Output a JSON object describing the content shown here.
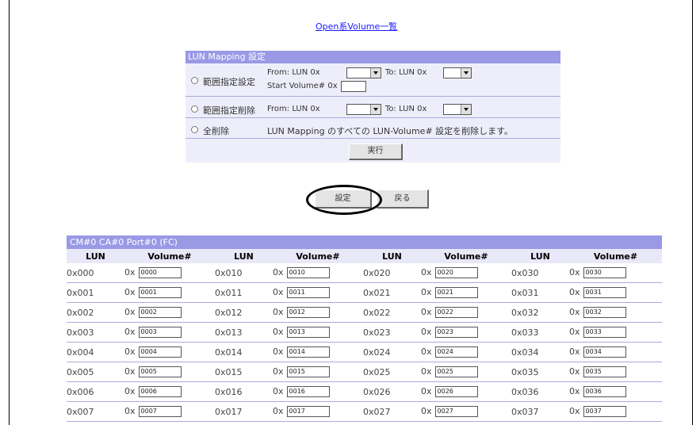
{
  "top_link": "Open系Volume一覧",
  "lun_mapping": {
    "title": "LUN Mapping 設定",
    "range_set": {
      "label": "範囲指定設定",
      "from_label": "From: LUN 0x",
      "to_label": "To: LUN 0x",
      "start_label": "Start Volume# 0x"
    },
    "range_delete": {
      "label": "範囲指定削除",
      "from_label": "From: LUN 0x",
      "to_label": "To: LUN 0x"
    },
    "delete_all": {
      "label": "全削除",
      "description": "LUN Mapping のすべての LUN-Volume# 設定を削除します。"
    },
    "execute_button": "実行"
  },
  "actions": {
    "set_button": "設定",
    "back_button": "戻る"
  },
  "cm_table": {
    "title": "CM#0 CA#0 Port#0 (FC)",
    "headers": [
      "LUN",
      "Volume#",
      "LUN",
      "Volume#",
      "LUN",
      "Volume#",
      "LUN",
      "Volume#"
    ],
    "volume_prefix": "0x",
    "rows": [
      [
        [
          "0x000",
          "0000"
        ],
        [
          "0x010",
          "0010"
        ],
        [
          "0x020",
          "0020"
        ],
        [
          "0x030",
          "0030"
        ]
      ],
      [
        [
          "0x001",
          "0001"
        ],
        [
          "0x011",
          "0011"
        ],
        [
          "0x021",
          "0021"
        ],
        [
          "0x031",
          "0031"
        ]
      ],
      [
        [
          "0x002",
          "0002"
        ],
        [
          "0x012",
          "0012"
        ],
        [
          "0x022",
          "0022"
        ],
        [
          "0x032",
          "0032"
        ]
      ],
      [
        [
          "0x003",
          "0003"
        ],
        [
          "0x013",
          "0013"
        ],
        [
          "0x023",
          "0023"
        ],
        [
          "0x033",
          "0033"
        ]
      ],
      [
        [
          "0x004",
          "0004"
        ],
        [
          "0x014",
          "0014"
        ],
        [
          "0x024",
          "0024"
        ],
        [
          "0x034",
          "0034"
        ]
      ],
      [
        [
          "0x005",
          "0005"
        ],
        [
          "0x015",
          "0015"
        ],
        [
          "0x025",
          "0025"
        ],
        [
          "0x035",
          "0035"
        ]
      ],
      [
        [
          "0x006",
          "0006"
        ],
        [
          "0x016",
          "0016"
        ],
        [
          "0x026",
          "0026"
        ],
        [
          "0x036",
          "0036"
        ]
      ],
      [
        [
          "0x007",
          "0007"
        ],
        [
          "0x017",
          "0017"
        ],
        [
          "0x027",
          "0027"
        ],
        [
          "0x037",
          "0037"
        ]
      ]
    ]
  },
  "colors": {
    "header_bg": "#9999e6",
    "panel_bg": "#eeeefb",
    "link": "#1a1aff"
  }
}
